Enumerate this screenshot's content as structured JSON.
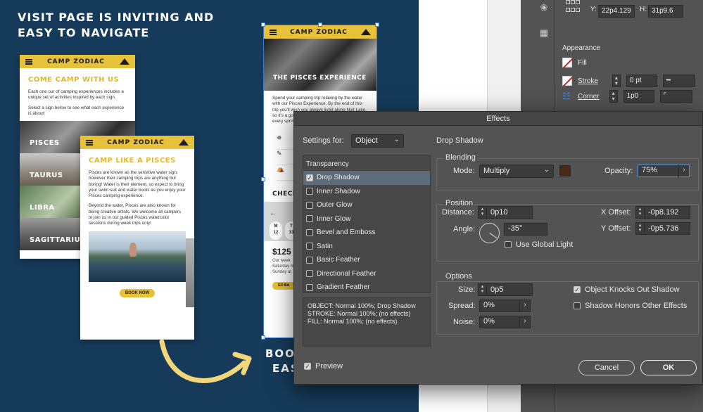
{
  "canvas": {
    "headline_line1": "VISIT PAGE IS INVITING AND",
    "headline_line2": "EASY TO NAVIGATE",
    "headline2_line1": "BOO",
    "headline2_line2": "EAS",
    "mock1": {
      "brand": "CAMP ZODIAC",
      "title": "COME CAMP WITH US",
      "para1": "Each one our of camping experiences includes a unique set of activities inspired by each sign.",
      "para2": "Select a sign below to see what each experience is about!",
      "signs": [
        "PISCES",
        "TAURUS",
        "LIBRA",
        "SAGITTARIUS"
      ]
    },
    "mock2": {
      "brand": "CAMP ZODIAC",
      "title": "CAMP LIKE A PISCES",
      "para1": "Pisces are known as the sensitive water sign, however their camping trips are anything but boring! Water is their element, so expect to bring your swim suit and water boots as you enjoy your Pisces camping experience.",
      "para2": "Beyond the water, Pisces are also known for being creative artists. We welcome all campers to join us in our guided Pisces watercolor sessions during week trips only!",
      "button": "BOOK NOW"
    },
    "mock3": {
      "brand": "CAMP ZODIAC",
      "hero": "THE PISCES EXPERIENCE",
      "para": "Spend your camping trip relaxing by the water with our Pisces Experience. By the end of this trip you'll wish you always lived along Nuit Lake, so it's a good thing we offer this experience every spring!",
      "check": "CHECK",
      "cal_days": [
        {
          "d": "M",
          "n": "12"
        },
        {
          "d": "T",
          "n": "13"
        },
        {
          "d": "W",
          "n": "14"
        }
      ],
      "price": "$125",
      "small1": "Our week",
      "small2": "Saturday m",
      "small3": "Sunday at",
      "button": "GO BA"
    }
  },
  "right_panel": {
    "y_label": "Y:",
    "y_value": "22p4.129",
    "h_label": "H:",
    "h_value": "31p9.6",
    "appearance_title": "Appearance",
    "fill_label": "Fill",
    "stroke_label": "Stroke",
    "stroke_value": "0 pt",
    "corner_label": "Corner",
    "corner_value": "1p0"
  },
  "dialog": {
    "title": "Effects",
    "settings_for_label": "Settings for:",
    "settings_for_value": "Object",
    "section_title": "Drop Shadow",
    "list_header": "Transparency",
    "effects": [
      {
        "label": "Drop Shadow",
        "checked": true
      },
      {
        "label": "Inner Shadow",
        "checked": false
      },
      {
        "label": "Outer Glow",
        "checked": false
      },
      {
        "label": "Inner Glow",
        "checked": false
      },
      {
        "label": "Bevel and Emboss",
        "checked": false
      },
      {
        "label": "Satin",
        "checked": false
      },
      {
        "label": "Basic Feather",
        "checked": false
      },
      {
        "label": "Directional Feather",
        "checked": false
      },
      {
        "label": "Gradient Feather",
        "checked": false
      }
    ],
    "summary_line1": "OBJECT: Normal 100%; Drop Shadow",
    "summary_line2": "STROKE: Normal 100%; (no effects)",
    "summary_line3": "FILL: Normal 100%; (no effects)",
    "blending": {
      "title": "Blending",
      "mode_label": "Mode:",
      "mode_value": "Multiply",
      "opacity_label": "Opacity:",
      "opacity_value": "75%",
      "color": "#4a2a14"
    },
    "position": {
      "title": "Position",
      "distance_label": "Distance:",
      "distance_value": "0p10",
      "angle_label": "Angle:",
      "angle_value": "-35°",
      "global_light_label": "Use Global Light",
      "x_offset_label": "X Offset:",
      "x_offset_value": "-0p8.192",
      "y_offset_label": "Y Offset:",
      "y_offset_value": "-0p5.736"
    },
    "options": {
      "title": "Options",
      "size_label": "Size:",
      "size_value": "0p5",
      "spread_label": "Spread:",
      "spread_value": "0%",
      "noise_label": "Noise:",
      "noise_value": "0%",
      "knocks_out_label": "Object Knocks Out Shadow",
      "honors_label": "Shadow Honors Other Effects"
    },
    "preview_label": "Preview",
    "cancel_label": "Cancel",
    "ok_label": "OK"
  }
}
